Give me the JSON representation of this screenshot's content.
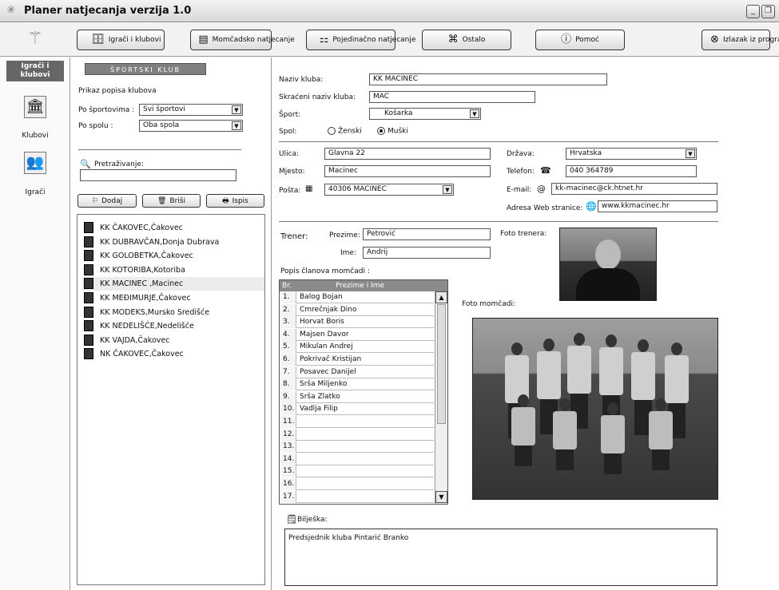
{
  "window": {
    "title": "Planer natjecanja verzija 1.0",
    "minimize": "_",
    "restore": "❐"
  },
  "toolbar": {
    "players_clubs": "Igrači i klubovi",
    "team_comp": "Momčadsko natjecanje",
    "individual_comp": "Pojedinačno natjecanje",
    "other": "Ostalo",
    "help": "Pomoć",
    "exit": "Izlazak iz programa"
  },
  "sidebar": {
    "header": "Igrači i klubovi",
    "clubs_label": "Klubovi",
    "players_label": "Igrači"
  },
  "club_panel": {
    "banner": "ŠPORTSKI KLUB",
    "list_heading": "Prikaz popisa klubova",
    "sport_label": "Po športovima :",
    "sport_value": "Svi športovi",
    "gender_label": "Po spolu :",
    "gender_value": "Oba spola",
    "search_label": "Pretraživanje:",
    "search_value": "",
    "add_label": "Dodaj",
    "delete_label": "Briši",
    "print_label": "Ispis",
    "clubs": [
      "KK ČAKOVEC,Čakovec",
      "KK DUBRAVČAN,Donja Dubrava",
      "KK GOLOBETKA,Čakovec",
      "KK KOTORIBA,Kotoriba",
      "KK MACINEC ,Macinec",
      "KK MEĐIMURJE,Čakovec",
      "KK MODEKS,Mursko Središće",
      "KK NEDELIŠĆE,Nedelišće",
      "KK VAJDA,Čakovec",
      "NK ČAKOVEC,Čakovec"
    ],
    "selected_index": 4
  },
  "form": {
    "club_name_label": "Naziv kluba:",
    "club_name": "KK MACINEC",
    "short_name_label": "Skraćeni naziv kluba:",
    "short_name": "MAC",
    "sport_label": "Šport:",
    "sport": "Košarka",
    "gender_label": "Spol:",
    "female": "Ženski",
    "male": "Muški",
    "street_label": "Ulica:",
    "street": "Glavna 22",
    "place_label": "Mjesto:",
    "place": "Macinec",
    "post_label": "Pošta:",
    "post": "40306 MACINEC",
    "country_label": "Država:",
    "country": "Hrvatska",
    "phone_label": "Telefon:",
    "phone": "040 364789",
    "email_label": "E-mail:",
    "email": "kk-macinec@ck.htnet.hr",
    "web_label": "Adresa Web stranice:",
    "web": "www.kkmacinec.hr",
    "coach_label": "Trener:",
    "surname_label": "Prezime:",
    "surname": "Petrović",
    "name_label": "Ime:",
    "name": "Andrij",
    "coach_photo_label": "Foto trenera:",
    "team_photo_label": "Foto momčadi:",
    "roster_label": "Popis članova momčadi :",
    "roster_col_no": "Br.",
    "roster_col_name": "Prezime i Ime",
    "roster": [
      "Balog Bojan",
      "Cmrečnjak Dino",
      "Horvat Boris",
      "Majsen Davor",
      "Mikulan Andrej",
      "Pokrivač Kristijan",
      "Posavec Danijel",
      "Srša Miljenko",
      "Srša Zlatko",
      "Vadlja Filip",
      "",
      "",
      "",
      "",
      "",
      "",
      ""
    ],
    "roster_numbers": [
      "1.",
      "2.",
      "3.",
      "4.",
      "5.",
      "6.",
      "7.",
      "8.",
      "9.",
      "10.",
      "11.",
      "12.",
      "13.",
      "14.",
      "15.",
      "16.",
      "17."
    ],
    "notes_label": "Bilješka:",
    "notes": "Predsjednik kluba Pintarić Branko"
  }
}
